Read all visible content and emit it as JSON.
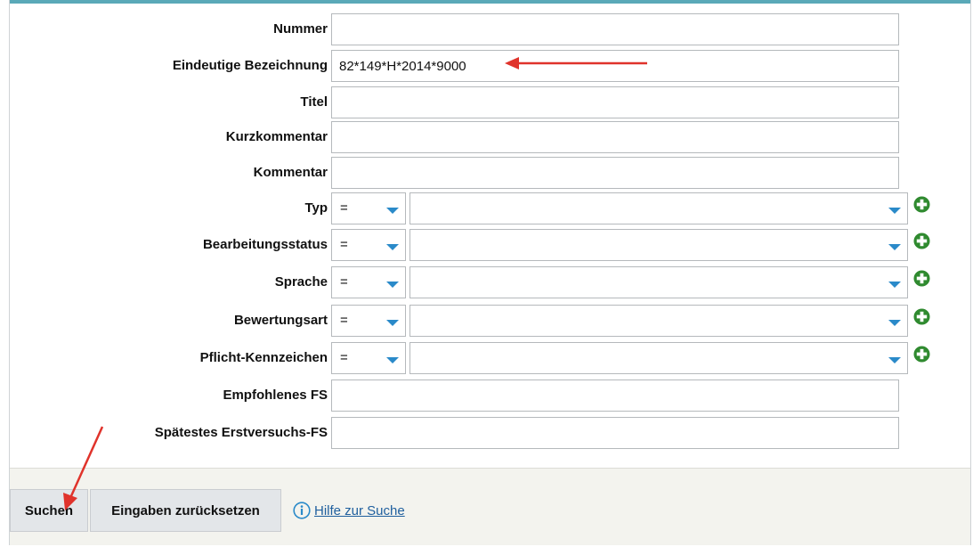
{
  "form": {
    "nummer": {
      "label": "Nummer",
      "value": ""
    },
    "bezeichnung": {
      "label": "Eindeutige Bezeichnung",
      "value": "82*149*H*2014*9000"
    },
    "titel": {
      "label": "Titel",
      "value": ""
    },
    "kurzkommentar": {
      "label": "Kurzkommentar",
      "value": ""
    },
    "kommentar": {
      "label": "Kommentar",
      "value": ""
    },
    "typ": {
      "label": "Typ",
      "operator": "=",
      "value": ""
    },
    "bearbeitungsstatus": {
      "label": "Bearbeitungsstatus",
      "operator": "=",
      "value": ""
    },
    "sprache": {
      "label": "Sprache",
      "operator": "=",
      "value": ""
    },
    "bewertungsart": {
      "label": "Bewertungsart",
      "operator": "=",
      "value": ""
    },
    "pflicht": {
      "label": "Pflicht-Kennzeichen",
      "operator": "=",
      "value": ""
    },
    "empfohlenes_fs": {
      "label": "Empfohlenes FS",
      "value": ""
    },
    "spaetestes_fs": {
      "label": "Spätestes Erstversuchs-FS",
      "value": ""
    }
  },
  "footer": {
    "search_label": "Suchen",
    "reset_label": "Eingaben zurücksetzen",
    "help_label": "Hilfe zur Suche"
  },
  "icons": {
    "chevron": "chevron-down-icon",
    "add": "plus-circle-icon",
    "info": "info-icon"
  },
  "colors": {
    "accent_line": "#5aa9b8",
    "chevron": "#2a8ac9",
    "add_icon": "#2f8a2f",
    "annotation_arrow": "#e0332b",
    "link": "#1f5f9e"
  }
}
